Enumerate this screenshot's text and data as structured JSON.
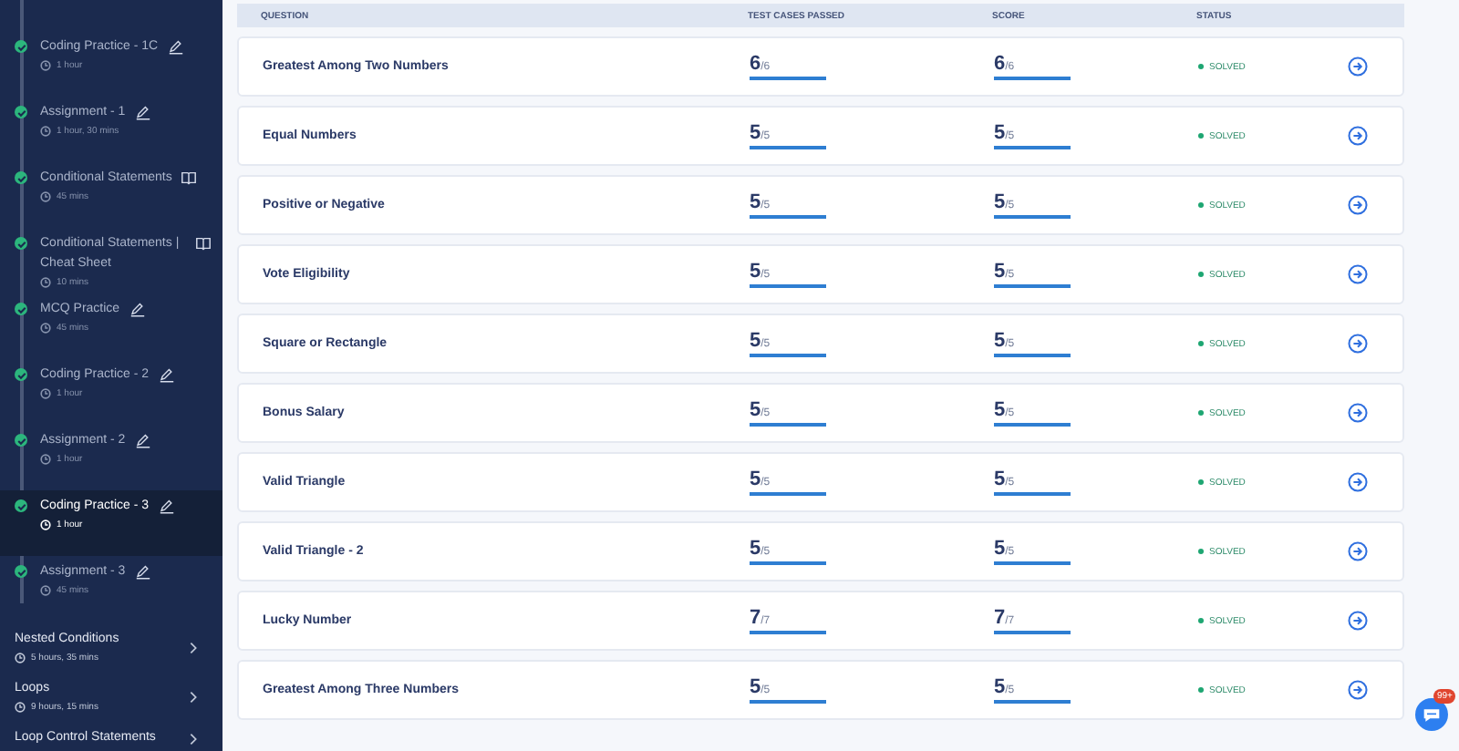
{
  "sidebar": {
    "items": [
      {
        "title": "Coding Practice - 1C",
        "duration": "1 hour",
        "kind": "edit",
        "completed": true,
        "selected": false
      },
      {
        "title": "Assignment - 1",
        "duration": "1 hour, 30 mins",
        "kind": "edit",
        "completed": true,
        "selected": false
      },
      {
        "title": "Conditional Statements",
        "duration": "45 mins",
        "kind": "book",
        "completed": true,
        "selected": false
      },
      {
        "title": "Conditional Statements | Cheat Sheet",
        "duration": "10 mins",
        "kind": "book",
        "completed": true,
        "selected": false
      },
      {
        "title": "MCQ Practice",
        "duration": "45 mins",
        "kind": "edit",
        "completed": true,
        "selected": false
      },
      {
        "title": "Coding Practice - 2",
        "duration": "1 hour",
        "kind": "edit",
        "completed": true,
        "selected": false
      },
      {
        "title": "Assignment - 2",
        "duration": "1 hour",
        "kind": "edit",
        "completed": true,
        "selected": false
      },
      {
        "title": "Coding Practice - 3",
        "duration": "1 hour",
        "kind": "edit",
        "completed": true,
        "selected": true
      },
      {
        "title": "Assignment - 3",
        "duration": "45 mins",
        "kind": "edit",
        "completed": true,
        "selected": false
      }
    ],
    "sections": [
      {
        "title": "Nested Conditions",
        "duration": "5 hours, 35 mins"
      },
      {
        "title": "Loops",
        "duration": "9 hours, 15 mins"
      },
      {
        "title": "Loop Control Statements"
      }
    ]
  },
  "table": {
    "columns": [
      "QUESTION",
      "TEST CASES PASSED",
      "SCORE",
      "STATUS"
    ],
    "rows": [
      {
        "question": "Greatest Among Two Numbers",
        "passed": {
          "value": "6",
          "total": "/6",
          "level": 1
        },
        "score": {
          "value": "6",
          "total": "/6",
          "level": 1
        },
        "status": "SOLVED"
      },
      {
        "question": "Equal Numbers",
        "passed": {
          "value": "5",
          "total": "/5",
          "level": 1
        },
        "score": {
          "value": "5",
          "total": "/5",
          "level": 1
        },
        "status": "SOLVED"
      },
      {
        "question": "Positive or Negative",
        "passed": {
          "value": "5",
          "total": "/5",
          "level": 1
        },
        "score": {
          "value": "5",
          "total": "/5",
          "level": 1
        },
        "status": "SOLVED"
      },
      {
        "question": "Vote Eligibility",
        "passed": {
          "value": "5",
          "total": "/5",
          "level": 1
        },
        "score": {
          "value": "5",
          "total": "/5",
          "level": 1
        },
        "status": "SOLVED"
      },
      {
        "question": "Square or Rectangle",
        "passed": {
          "value": "5",
          "total": "/5",
          "level": 1
        },
        "score": {
          "value": "5",
          "total": "/5",
          "level": 1
        },
        "status": "SOLVED"
      },
      {
        "question": "Bonus Salary",
        "passed": {
          "value": "5",
          "total": "/5",
          "level": 1
        },
        "score": {
          "value": "5",
          "total": "/5",
          "level": 1
        },
        "status": "SOLVED"
      },
      {
        "question": "Valid Triangle",
        "passed": {
          "value": "5",
          "total": "/5",
          "level": 1
        },
        "score": {
          "value": "5",
          "total": "/5",
          "level": 1
        },
        "status": "SOLVED"
      },
      {
        "question": "Valid Triangle - 2",
        "passed": {
          "value": "5",
          "total": "/5",
          "level": 1
        },
        "score": {
          "value": "5",
          "total": "/5",
          "level": 1
        },
        "status": "SOLVED"
      },
      {
        "question": "Lucky Number",
        "passed": {
          "value": "7",
          "total": "/7",
          "level": 1
        },
        "score": {
          "value": "7",
          "total": "/7",
          "level": 1
        },
        "status": "SOLVED"
      },
      {
        "question": "Greatest Among Three Numbers",
        "passed": {
          "value": "5",
          "total": "/5",
          "level": 1
        },
        "score": {
          "value": "5",
          "total": "/5",
          "level": 1
        },
        "status": "SOLVED"
      }
    ]
  },
  "chat": {
    "badge": "99+"
  }
}
